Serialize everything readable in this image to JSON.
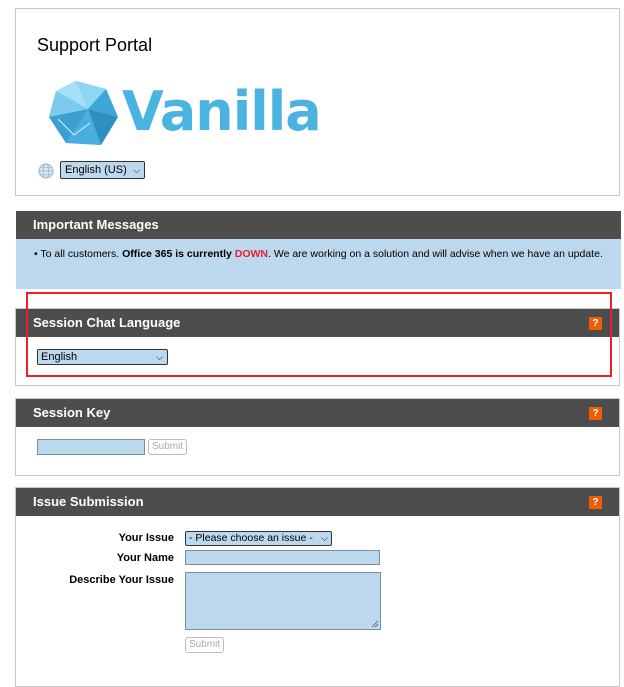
{
  "portal": {
    "title": "Support Portal",
    "logo_text": "Vanilla",
    "language_selected": "English (US)"
  },
  "messages": {
    "heading": "Important Messages",
    "bullet": "•",
    "pre": "To all customers. ",
    "bold": "Office 365 is currently ",
    "status": "DOWN",
    "post": ". We are working on a solution and will advise when we have an update."
  },
  "chat_language": {
    "heading": "Session Chat Language",
    "help_label": "?",
    "selected": "English"
  },
  "session_key": {
    "heading": "Session Key",
    "help_label": "?",
    "input_value": "",
    "submit_label": "Submit"
  },
  "issue": {
    "heading": "Issue Submission",
    "help_label": "?",
    "issue_label": "Your Issue",
    "issue_selected": "- Please choose an issue -",
    "name_label": "Your Name",
    "name_value": "",
    "describe_label": "Describe Your Issue",
    "describe_value": "",
    "submit_label": "Submit"
  },
  "colors": {
    "header_bg": "#4d4d4d",
    "message_bg": "#bcd8ec",
    "field_bg": "#bcd8ec",
    "help_orange": "#f25c05",
    "down_red": "#e8212a",
    "highlight_red": "#e8212a",
    "logo_blue": "#4ab3e0"
  },
  "icons": [
    "globe-icon",
    "chevron-down-icon",
    "question-icon",
    "vanilla-logo-icon"
  ]
}
